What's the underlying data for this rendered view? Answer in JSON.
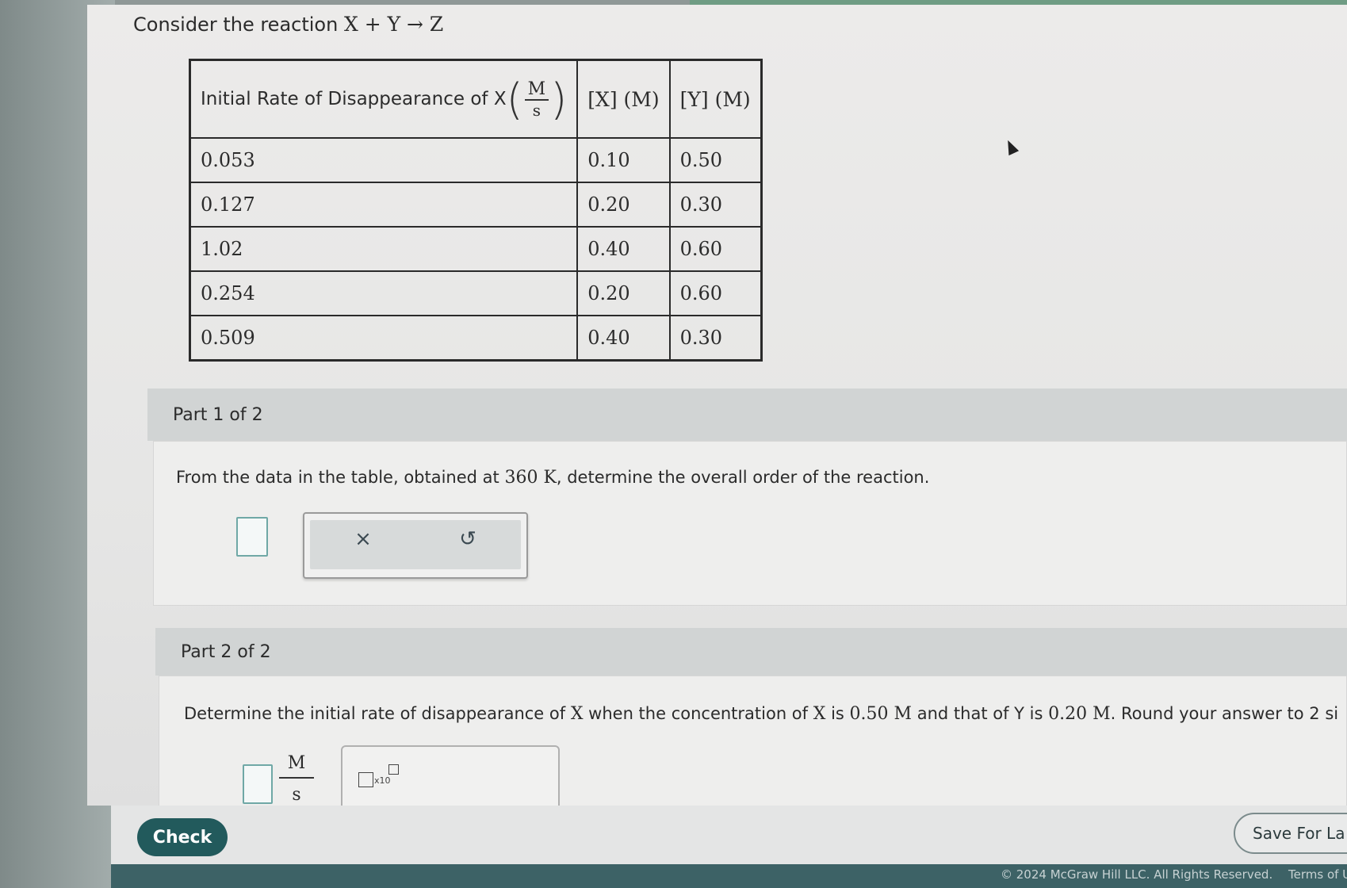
{
  "intro": {
    "text_prefix": "Consider the reaction ",
    "reaction": "X + Y → Z"
  },
  "table": {
    "header_rate_label": "Initial Rate of Disappearance of X",
    "header_rate_unit_num": "M",
    "header_rate_unit_den": "s",
    "header_x": "[X] (M)",
    "header_y": "[Y] (M)",
    "rows": [
      {
        "rate": "0.053",
        "x": "0.10",
        "y": "0.50"
      },
      {
        "rate": "0.127",
        "x": "0.20",
        "y": "0.30"
      },
      {
        "rate": "1.02",
        "x": "0.40",
        "y": "0.60"
      },
      {
        "rate": "0.254",
        "x": "0.20",
        "y": "0.60"
      },
      {
        "rate": "0.509",
        "x": "0.40",
        "y": "0.30"
      }
    ]
  },
  "part1": {
    "title": "Part 1 of 2",
    "prompt_a": "From the data in the table, obtained at ",
    "prompt_temp": "360 K",
    "prompt_b": ", determine the overall order of the reaction.",
    "answer_value": "",
    "clear_icon": "×",
    "undo_icon": "↺"
  },
  "part2": {
    "title": "Part 2 of 2",
    "prompt_a": "Determine the initial rate of disappearance of ",
    "prompt_x": "X",
    "prompt_b": " when the concentration of ",
    "prompt_x2": "X",
    "prompt_c": " is ",
    "prompt_xconc": "0.50 M",
    "prompt_d": " and that of Y is ",
    "prompt_yconc": "0.20 M",
    "prompt_e": ". Round your answer to 2 si",
    "answer_value": "",
    "unit_num": "M",
    "unit_den": "s",
    "sci_label": "x10"
  },
  "footer": {
    "check_label": "Check",
    "save_label": "Save For La",
    "copyright": "© 2024 McGraw Hill LLC. All Rights Reserved.",
    "terms": "Terms of U"
  },
  "colors": {
    "check_button": "#225a5c",
    "answer_border": "#6fa8a6",
    "footer_bar": "#3d6266"
  }
}
